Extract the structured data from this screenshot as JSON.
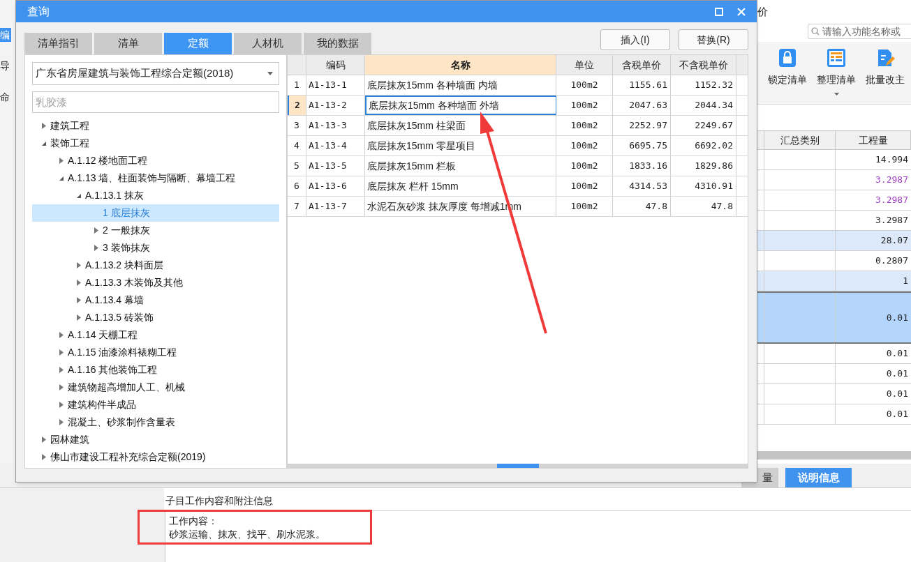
{
  "background_app": {
    "title_fragment": "价",
    "search": {
      "placeholder": "请输入功能名称或"
    },
    "left_strip": [
      {
        "label": "编",
        "selected": true
      },
      {
        "label": "导",
        "selected": false
      },
      {
        "label": "命",
        "selected": false
      }
    ],
    "toolbar": [
      {
        "label": "锁定清单",
        "dropdown": false
      },
      {
        "label": "整理清单",
        "dropdown": true
      },
      {
        "label": "批量改主",
        "dropdown": false
      }
    ],
    "table": {
      "columns": [
        "汇总类别",
        "工程量"
      ],
      "rows": [
        {
          "quantity": "14.994",
          "kind": "plain",
          "selected": false,
          "color": "#222222"
        },
        {
          "quantity": "3.2987",
          "kind": "plain",
          "selected": false,
          "color": "#a040c0"
        },
        {
          "quantity": "3.2987",
          "kind": "plain",
          "selected": false,
          "color": "#a040c0"
        },
        {
          "quantity": "3.2987",
          "kind": "plain",
          "selected": false,
          "color": "#222222"
        },
        {
          "quantity": "28.07",
          "kind": "group",
          "selected": false,
          "color": "#222222"
        },
        {
          "quantity": "0.2807",
          "kind": "plain",
          "selected": false,
          "color": "#222222"
        },
        {
          "quantity": "1",
          "kind": "group",
          "selected": false,
          "color": "#222222"
        },
        {
          "quantity": "0.01",
          "kind": "plain",
          "selected": true,
          "color": "#222222"
        },
        {
          "quantity": "0.01",
          "kind": "plain",
          "selected": false,
          "color": "#222222"
        },
        {
          "quantity": "0.01",
          "kind": "plain",
          "selected": false,
          "color": "#222222"
        },
        {
          "quantity": "0.01",
          "kind": "plain",
          "selected": false,
          "color": "#222222"
        },
        {
          "quantity": "0.01",
          "kind": "plain",
          "selected": false,
          "color": "#222222"
        }
      ]
    },
    "bottom_tabs": [
      {
        "label": "量",
        "selected": false
      },
      {
        "label": "说明信息",
        "selected": true
      }
    ],
    "detail_caption": "子目工作内容和附注信息",
    "detail_lines": [
      "工作内容：",
      "砂浆运输、抹灰、找平、刷水泥浆。"
    ]
  },
  "dialog": {
    "title": "查询",
    "tabs": [
      {
        "label": "清单指引",
        "selected": false
      },
      {
        "label": "清单",
        "selected": false
      },
      {
        "label": "定额",
        "selected": true
      },
      {
        "label": "人材机",
        "selected": false
      },
      {
        "label": "我的数据",
        "selected": false
      }
    ],
    "buttons": [
      "插入(I)",
      "替换(R)"
    ],
    "library": "广东省房屋建筑与装饰工程综合定额(2018)",
    "search": {
      "placeholder": "乳胶漆"
    },
    "tree": [
      {
        "label": "建筑工程",
        "expanded": false,
        "selected": false
      },
      {
        "label": "装饰工程",
        "expanded": true,
        "selected": false,
        "children": [
          {
            "label": "A.1.12 楼地面工程",
            "expanded": false,
            "selected": false
          },
          {
            "label": "A.1.13 墙、柱面装饰与隔断、幕墙工程",
            "expanded": true,
            "selected": false,
            "children": [
              {
                "label": "A.1.13.1 抹灰",
                "expanded": true,
                "selected": false,
                "children": [
                  {
                    "label": "1 底层抹灰",
                    "selected": true
                  },
                  {
                    "label": "2 一般抹灰",
                    "expanded": false,
                    "selected": false
                  },
                  {
                    "label": "3 装饰抹灰",
                    "expanded": false,
                    "selected": false
                  }
                ]
              },
              {
                "label": "A.1.13.2 块料面层",
                "expanded": false,
                "selected": false
              },
              {
                "label": "A.1.13.3 木装饰及其他",
                "expanded": false,
                "selected": false
              },
              {
                "label": "A.1.13.4 幕墙",
                "expanded": false,
                "selected": false
              },
              {
                "label": "A.1.13.5 砖装饰",
                "expanded": false,
                "selected": false
              }
            ]
          },
          {
            "label": "A.1.14 天棚工程",
            "expanded": false,
            "selected": false
          },
          {
            "label": "A.1.15 油漆涂料裱糊工程",
            "expanded": false,
            "selected": false
          },
          {
            "label": "A.1.16 其他装饰工程",
            "expanded": false,
            "selected": false
          },
          {
            "label": "建筑物超高增加人工、机械",
            "expanded": false,
            "selected": false
          },
          {
            "label": "建筑构件半成品",
            "expanded": false,
            "selected": false
          },
          {
            "label": "混凝土、砂浆制作含量表",
            "expanded": false,
            "selected": false
          }
        ]
      },
      {
        "label": "园林建筑",
        "expanded": false,
        "selected": false
      },
      {
        "label": "佛山市建设工程补充综合定额(2019)",
        "expanded": false,
        "selected": false
      }
    ],
    "table": {
      "columns": [
        {
          "label": "编码",
          "active": false
        },
        {
          "label": "名称",
          "active": true
        },
        {
          "label": "单位",
          "active": false
        },
        {
          "label": "含税单价",
          "active": false
        },
        {
          "label": "不含税单价",
          "active": false
        }
      ],
      "rows": [
        {
          "index": "1",
          "code": "A1-13-1",
          "name": "底层抹灰15mm 各种墙面 内墙",
          "unit": "100m2",
          "price_tax": "1155.61",
          "price_notax": "1152.32",
          "selected": false
        },
        {
          "index": "2",
          "code": "A1-13-2",
          "name": "底层抹灰15mm 各种墙面 外墙",
          "unit": "100m2",
          "price_tax": "2047.63",
          "price_notax": "2044.34",
          "selected": true
        },
        {
          "index": "3",
          "code": "A1-13-3",
          "name": "底层抹灰15mm 柱梁面",
          "unit": "100m2",
          "price_tax": "2252.97",
          "price_notax": "2249.67",
          "selected": false
        },
        {
          "index": "4",
          "code": "A1-13-4",
          "name": "底层抹灰15mm 零星项目",
          "unit": "100m2",
          "price_tax": "6695.75",
          "price_notax": "6692.02",
          "selected": false
        },
        {
          "index": "5",
          "code": "A1-13-5",
          "name": "底层抹灰15mm 栏板",
          "unit": "100m2",
          "price_tax": "1833.16",
          "price_notax": "1829.86",
          "selected": false
        },
        {
          "index": "6",
          "code": "A1-13-6",
          "name": "底层抹灰 栏杆 15mm",
          "unit": "100m2",
          "price_tax": "4314.53",
          "price_notax": "4310.91",
          "selected": false
        },
        {
          "index": "7",
          "code": "A1-13-7",
          "name": "水泥石灰砂浆 抹灰厚度 每增减1mm",
          "unit": "100m2",
          "price_tax": "47.8",
          "price_notax": "47.8",
          "selected": false
        }
      ]
    }
  }
}
